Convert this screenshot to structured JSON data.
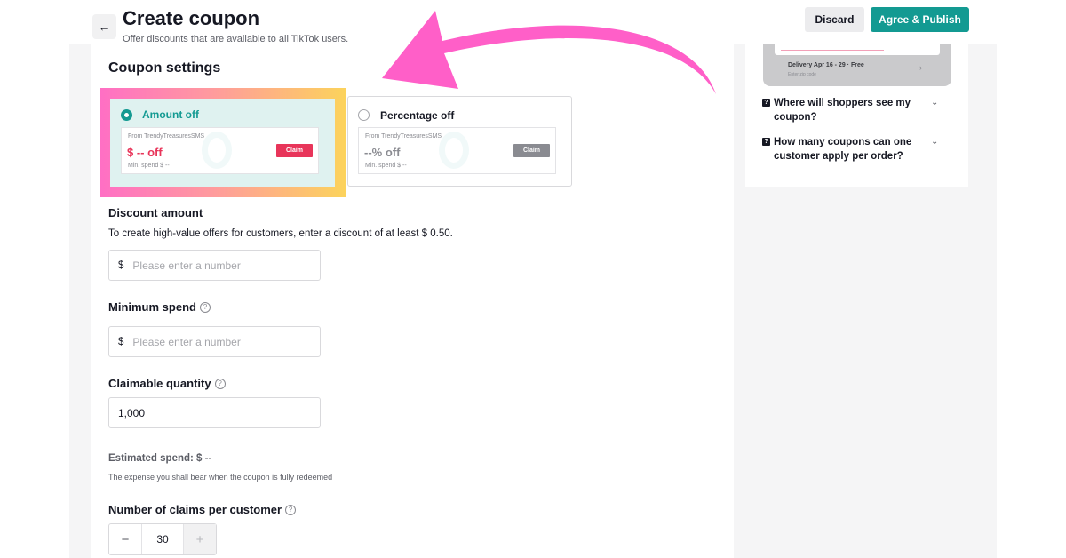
{
  "header": {
    "back_icon": "arrow-left-icon",
    "title": "Create coupon",
    "subtitle": "Offer discounts that are available to all TikTok users.",
    "discard_label": "Discard",
    "publish_label": "Agree & Publish",
    "accent_color": "#139a92"
  },
  "coupon_settings": {
    "title": "Coupon settings",
    "options": [
      {
        "label": "Amount off",
        "selected": true,
        "preview": {
          "from": "From TrendyTreasuresSMS",
          "value": "$ -- off",
          "min_spend": "Min. spend $ --",
          "claim": "Claim",
          "claim_color": "#e8355a"
        }
      },
      {
        "label": "Percentage off",
        "selected": false,
        "preview": {
          "from": "From TrendyTreasuresSMS",
          "value": "--% off",
          "min_spend": "Min. spend $ --",
          "claim": "Claim",
          "claim_color": "#8a8b91"
        }
      }
    ]
  },
  "discount_amount": {
    "label": "Discount amount",
    "hint": "To create high-value offers for customers, enter a discount of at least $ 0.50.",
    "prefix": "$",
    "placeholder": "Please enter a number"
  },
  "minimum_spend": {
    "label": "Minimum spend",
    "prefix": "$",
    "placeholder": "Please enter a number"
  },
  "claimable_quantity": {
    "label": "Claimable quantity",
    "value": "1,000"
  },
  "estimated_spend": {
    "label": "Estimated spend: $ --",
    "description": "The expense you shall bear when the coupon is fully redeemed"
  },
  "claims_per_customer": {
    "label": "Number of claims per customer",
    "minus": "−",
    "value": "30",
    "plus": "+"
  },
  "sidebar": {
    "phone_preview": {
      "delivery": "Delivery Apr 16 - 29 · Free",
      "zip": "Enter zip code"
    },
    "faqs": [
      {
        "question": "Where will shoppers see my coupon?"
      },
      {
        "question": "How many coupons can one customer apply per order?"
      }
    ]
  },
  "annotation": {
    "arrow_color": "#ff5fc8",
    "highlight_gradient": [
      "#ff6fc4",
      "#fcd35c"
    ]
  }
}
